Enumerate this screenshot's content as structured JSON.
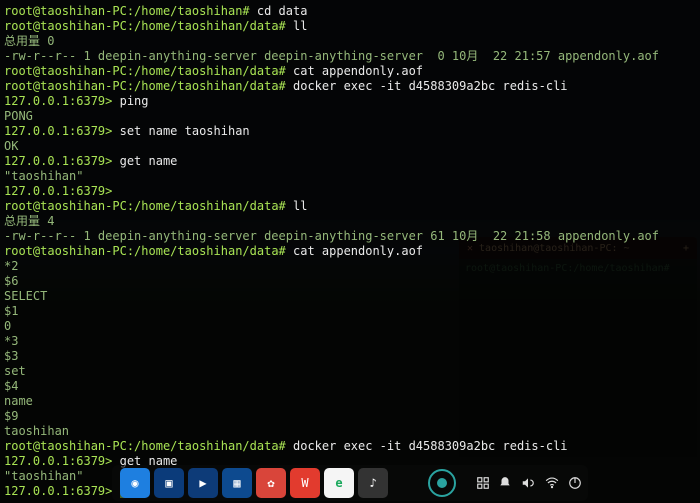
{
  "terminal": {
    "prompt_prefix": "root@taoshihan-PC",
    "lines": [
      {
        "host": "root@taoshihan-PC",
        "path": "/home/taoshihan",
        "cmd": "cd data"
      },
      {
        "host": "root@taoshihan-PC",
        "path": "/home/taoshihan/data",
        "cmd": "ll"
      },
      {
        "out": "总用量 0"
      },
      {
        "out": "-rw-r--r-- 1 deepin-anything-server deepin-anything-server  0 10月  22 21:57 appendonly.aof"
      },
      {
        "host": "root@taoshihan-PC",
        "path": "/home/taoshihan/data",
        "cmd": "cat appendonly.aof"
      },
      {
        "host": "root@taoshihan-PC",
        "path": "/home/taoshihan/data",
        "cmd": "docker exec -it d4588309a2bc redis-cli"
      },
      {
        "redis": "127.0.0.1:6379>",
        "cmd": "ping"
      },
      {
        "out": "PONG"
      },
      {
        "redis": "127.0.0.1:6379>",
        "cmd": "set name taoshihan"
      },
      {
        "out": "OK"
      },
      {
        "redis": "127.0.0.1:6379>",
        "cmd": "get name"
      },
      {
        "out": "\"taoshihan\""
      },
      {
        "redis": "127.0.0.1:6379>",
        "cmd": ""
      },
      {
        "host": "root@taoshihan-PC",
        "path": "/home/taoshihan/data",
        "cmd": "ll"
      },
      {
        "out": "总用量 4"
      },
      {
        "out": "-rw-r--r-- 1 deepin-anything-server deepin-anything-server 61 10月  22 21:58 appendonly.aof"
      },
      {
        "host": "root@taoshihan-PC",
        "path": "/home/taoshihan/data",
        "cmd": "cat appendonly.aof"
      },
      {
        "out": "*2"
      },
      {
        "out": "$6"
      },
      {
        "out": "SELECT"
      },
      {
        "out": "$1"
      },
      {
        "out": "0"
      },
      {
        "out": "*3"
      },
      {
        "out": "$3"
      },
      {
        "out": "set"
      },
      {
        "out": "$4"
      },
      {
        "out": "name"
      },
      {
        "out": "$9"
      },
      {
        "out": "taoshihan"
      },
      {
        "host": "root@taoshihan-PC",
        "path": "/home/taoshihan/data",
        "cmd": "docker exec -it d4588309a2bc redis-cli"
      },
      {
        "redis": "127.0.0.1:6379>",
        "cmd": "get name"
      },
      {
        "out": "\"taoshihan\""
      },
      {
        "redis": "127.0.0.1:6379>",
        "cmd": "",
        "cursor": true
      }
    ]
  },
  "ghost_window": {
    "title": "taoshihan@taoshihan-PC: ~",
    "body_hint": "root@taoshihan-PC:/home/taoshihan#"
  },
  "taskbar": {
    "icons": [
      {
        "name": "deepin-launcher-icon",
        "bg": "#1e7fe0",
        "glyph": "◉"
      },
      {
        "name": "deepin-appstore-icon",
        "bg": "#0b3b7a",
        "glyph": "▣"
      },
      {
        "name": "deepin-media-icon",
        "bg": "#0d3b78",
        "glyph": "▶"
      },
      {
        "name": "deepin-movie-icon",
        "bg": "#0d4a8f",
        "glyph": "▦"
      },
      {
        "name": "control-center-icon",
        "bg": "#d9453a",
        "glyph": "✿"
      },
      {
        "name": "wps-icon",
        "bg": "#e23b2e",
        "glyph": "W"
      },
      {
        "name": "browser-360-icon",
        "bg": "#f5f5f5",
        "glyph": "e"
      },
      {
        "name": "qq-music-icon",
        "bg": "#333",
        "glyph": "♪"
      },
      {
        "name": "terminal-icon",
        "bg": "rgba(0,0,0,0)",
        "glyph": ""
      }
    ]
  },
  "tray": {
    "items": [
      {
        "name": "camera-indicator-icon"
      },
      {
        "name": "screenshot-icon"
      },
      {
        "name": "notifications-icon"
      },
      {
        "name": "volume-icon"
      },
      {
        "name": "wifi-icon"
      },
      {
        "name": "power-icon"
      }
    ]
  }
}
